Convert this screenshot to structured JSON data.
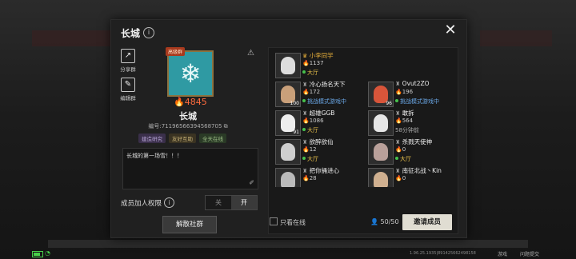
{
  "club": {
    "title": "长城",
    "badge": "高级群",
    "power": "4845",
    "name": "长城",
    "id_text": "编号:71196566394568705",
    "tags": [
      "建造研究",
      "友好互助",
      "全天在线"
    ],
    "description": "长城的第一场雪！！！",
    "permission_label": "成员加人权限",
    "toggle_off": "关",
    "toggle_on": "开",
    "disband_label": "解散社群"
  },
  "sidebar": {
    "share_label": "分享群",
    "edit_label": "编辑群"
  },
  "members": [
    {
      "name": "小李同学",
      "owner": true,
      "power": "1137",
      "status": "大厅",
      "status_type": "lobby",
      "level": "",
      "face": "#ddd"
    },
    {
      "name": "冷心扬名天下",
      "owner": false,
      "power": "172",
      "status": "挑战模式游戏中",
      "status_type": "battle",
      "level": "100",
      "face": "#c9a07a"
    },
    {
      "name": "Ovut2ZO",
      "owner": false,
      "power": "196",
      "status": "挑战模式游戏中",
      "status_type": "battle",
      "level": "96",
      "face": "#d8553a"
    },
    {
      "name": "超雄GGB",
      "owner": false,
      "power": "1086",
      "status": "大厅",
      "status_type": "lobby",
      "level": "91",
      "face": "#eee"
    },
    {
      "name": "敢拆",
      "owner": false,
      "power": "564",
      "status": "58分钟前",
      "status_type": "offline",
      "level": "",
      "face": "#e6e6e6"
    },
    {
      "name": "欲醉欲仙",
      "owner": false,
      "power": "12",
      "status": "大厅",
      "status_type": "lobby",
      "level": "",
      "face": "#cfcfcf"
    },
    {
      "name": "杀戮天使神",
      "owner": false,
      "power": "0",
      "status": "大厅",
      "status_type": "lobby",
      "level": "",
      "face": "#b9a09a"
    },
    {
      "name": "把你捅进心",
      "owner": false,
      "power": "28",
      "status": "",
      "status_type": "lobby",
      "level": "",
      "face": "#bbb"
    },
    {
      "name": "南征北战丶Kin",
      "owner": false,
      "power": "0",
      "status": "",
      "status_type": "lobby",
      "level": "",
      "face": "#d0b090"
    }
  ],
  "footer": {
    "online_only": "只看在线",
    "count": "50/50",
    "invite_label": "邀请成员"
  },
  "statusbar": {
    "version": "1.96.25.1935|891425662498158",
    "btn1": "游戏",
    "btn2": "问题提交"
  }
}
